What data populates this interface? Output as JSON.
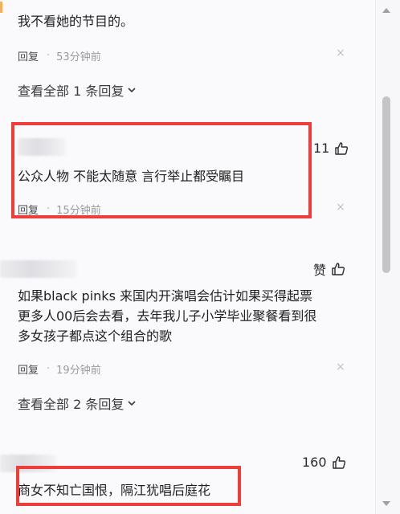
{
  "comment1": {
    "text": "我不看她的节目的。",
    "reply_label": "回复",
    "time": "53分钟前",
    "close_glyph": "×",
    "expand_label": "查看全部 1 条回复"
  },
  "comment2": {
    "likes": "11",
    "text": "公众人物 不能太随意 言行举止都受瞩目",
    "reply_label": "回复",
    "time": "15分钟前",
    "close_glyph": "×"
  },
  "comment3": {
    "likes": "赞",
    "lines": [
      "如果black pinks 来国内开演唱会估计如果买得起票",
      "更多人00后会去看，去年我儿子小学毕业聚餐看到很",
      "多女孩子都点这个组合的歌"
    ],
    "reply_label": "回复",
    "time": "19分钟前",
    "close_glyph": "×",
    "expand_label": "查看全部 2 条回复"
  },
  "comment4": {
    "likes": "160",
    "text": "商女不知亡国恨，隔江犹唱后庭花"
  },
  "colors": {
    "highlight_border": "#ef3e3a",
    "background": "#fafafc"
  },
  "icons": [
    "thumbs-up-icon",
    "close-icon",
    "chevron-down-icon"
  ]
}
